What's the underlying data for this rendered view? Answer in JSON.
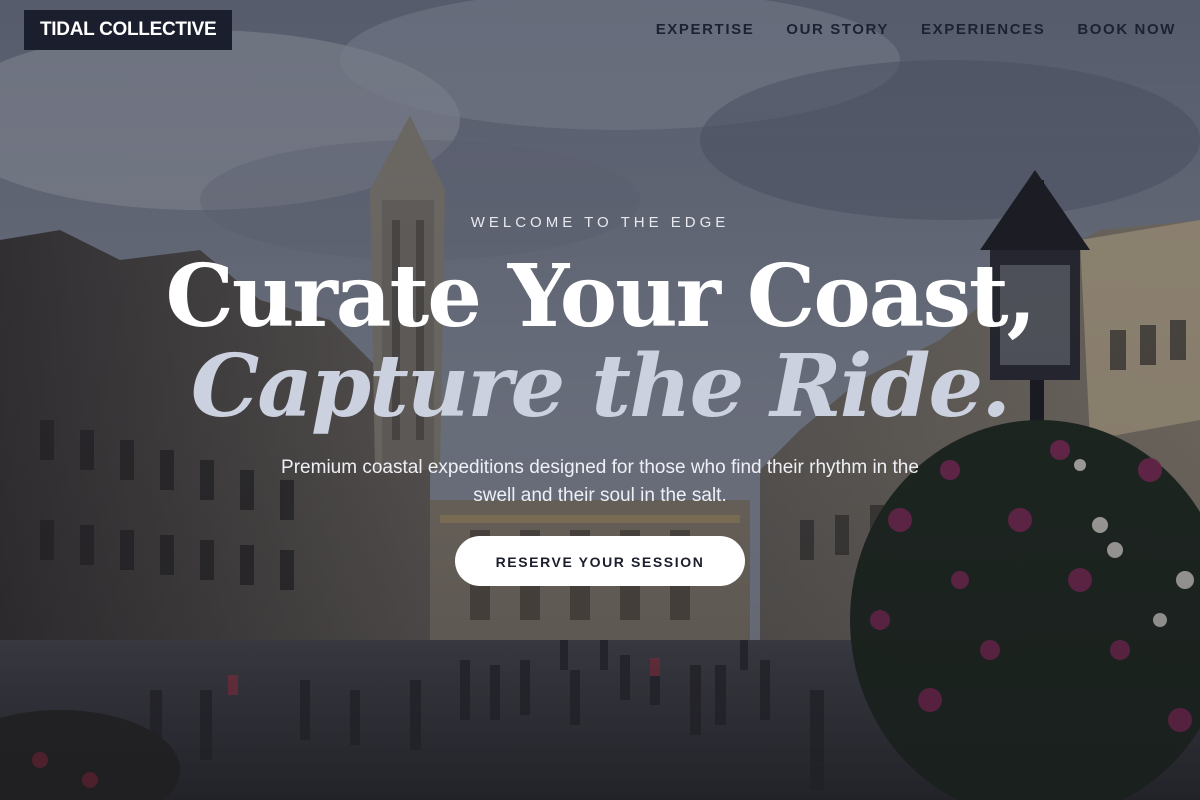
{
  "header": {
    "logo_text": "TIDAL COLLECTIVE",
    "nav": [
      {
        "label": "EXPERTISE"
      },
      {
        "label": "OUR STORY"
      },
      {
        "label": "EXPERIENCES"
      },
      {
        "label": "BOOK NOW"
      }
    ]
  },
  "hero": {
    "eyebrow": "WELCOME TO THE EDGE",
    "headline_line1": "Curate Your Coast,",
    "headline_line2": "Capture the Ride.",
    "subtitle": "Premium coastal expeditions designed for those who find their rhythm in the swell and their soul in the salt.",
    "cta_label": "RESERVE YOUR SESSION",
    "background_description_icon": "city-square-photo"
  },
  "colors": {
    "logo_bg": "#1b1e2c",
    "nav_text": "#1c2233",
    "headline_accent": "#ccd1df",
    "cta_bg": "#ffffff",
    "cta_text": "#1b1e2c"
  }
}
